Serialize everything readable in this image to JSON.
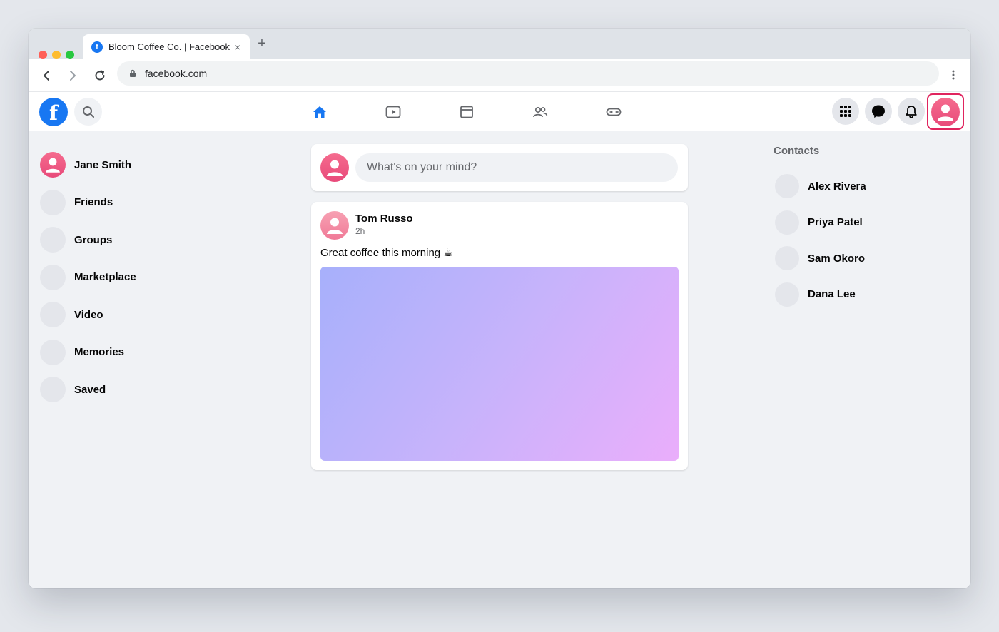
{
  "browser": {
    "tab_title": "Bloom Coffee Co. | Facebook",
    "tab_favicon": "f",
    "tab_close": "×",
    "new_tab": "+",
    "url": "facebook.com",
    "traffic_lights": [
      "#ff5f57",
      "#febc2e",
      "#28c840"
    ]
  },
  "header": {
    "logo": "f",
    "brand_color": "#1877f2",
    "nav": [
      "home-icon",
      "video-icon",
      "marketplace-icon",
      "groups-icon",
      "gaming-icon"
    ],
    "actions": [
      "menu-grid-icon",
      "messenger-icon",
      "notifications-icon"
    ]
  },
  "sidebar": {
    "items": [
      {
        "label": "Jane Smith"
      },
      {
        "label": "Friends"
      },
      {
        "label": "Groups"
      },
      {
        "label": "Marketplace"
      },
      {
        "label": "Video"
      },
      {
        "label": "Memories"
      },
      {
        "label": "Saved"
      }
    ]
  },
  "composer": {
    "placeholder": "What's on your mind?"
  },
  "post": {
    "author": "Tom Russo",
    "time": "2h",
    "text": "Great coffee this morning ☕"
  },
  "contacts": {
    "title": "Contacts",
    "items": [
      {
        "name": "Alex Rivera"
      },
      {
        "name": "Priya Patel"
      },
      {
        "name": "Sam Okoro"
      },
      {
        "name": "Dana Lee"
      }
    ]
  }
}
